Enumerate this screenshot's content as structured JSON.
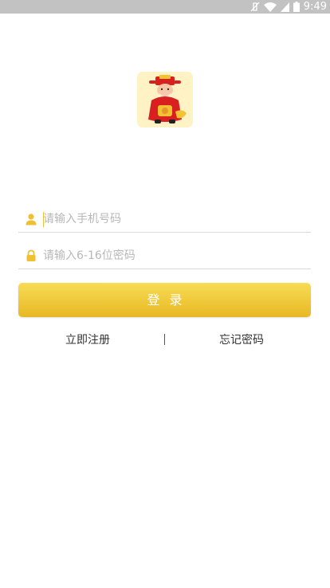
{
  "status_bar": {
    "time": "9:49",
    "icons": [
      "vibrate-off-icon",
      "wifi-icon",
      "signal-icon",
      "battery-icon"
    ]
  },
  "logo": {
    "icon": "god-of-wealth-mascot"
  },
  "form": {
    "phone_placeholder": "请输入手机号码",
    "password_placeholder": "请输入6-16位密码",
    "login_label": "登录"
  },
  "links": {
    "register": "立即注册",
    "forgot": "忘记密码"
  },
  "colors": {
    "accent": "#f0c030",
    "status_bar": "#c2c2c2",
    "divider": "#d9d9d9"
  }
}
